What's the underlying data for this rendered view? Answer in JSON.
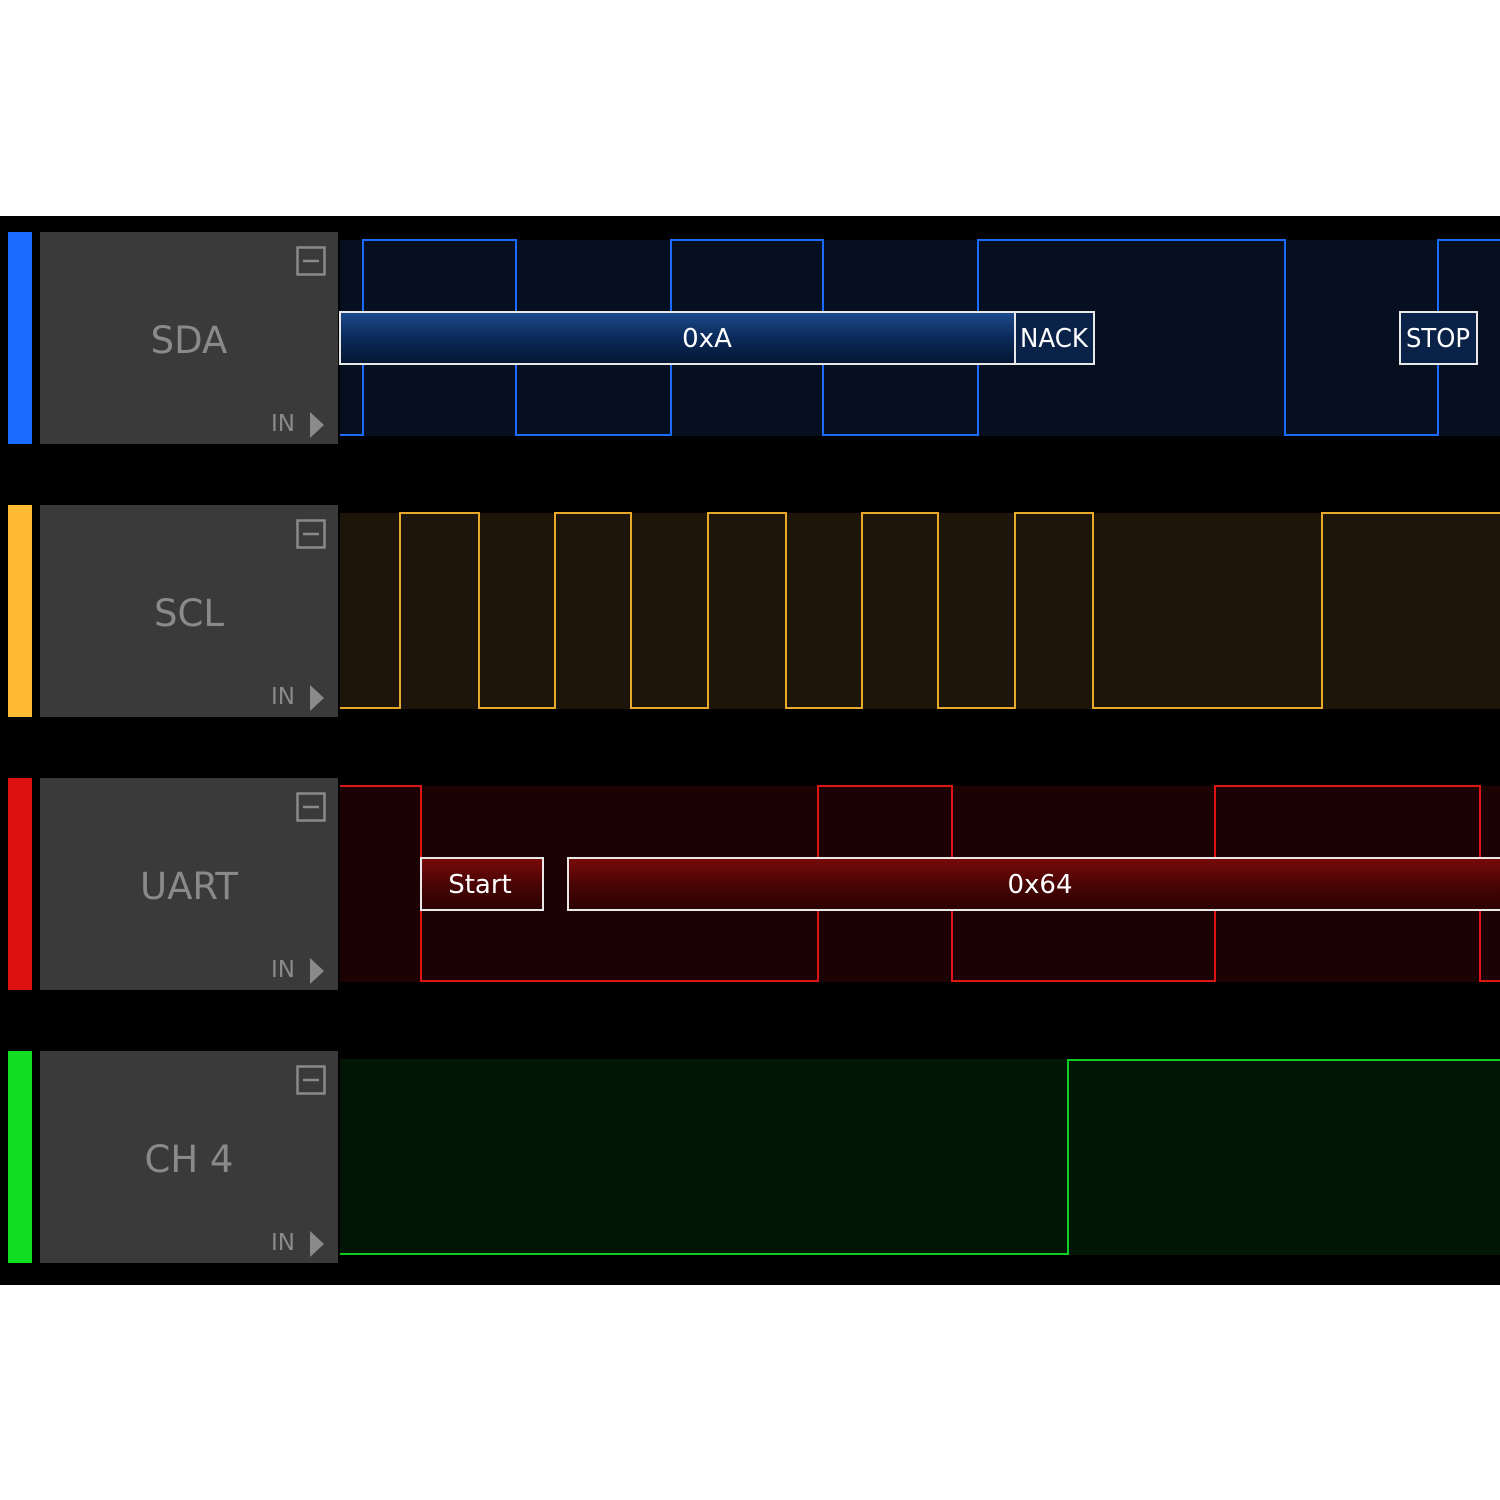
{
  "channels": [
    {
      "id": "sda",
      "name": "SDA",
      "io_label": "IN",
      "color": "#1a6cff",
      "bg_color": "#050f1f",
      "line_color": "#1a6cff",
      "decodes": [
        {
          "label": "0xA",
          "type": "data"
        },
        {
          "label": "NACK",
          "type": "ack"
        },
        {
          "label": "STOP",
          "type": "stop"
        }
      ]
    },
    {
      "id": "scl",
      "name": "SCL",
      "io_label": "IN",
      "color": "#ffbb33",
      "bg_color": "#1d150a",
      "line_color": "#e8a82a",
      "decodes": []
    },
    {
      "id": "uart",
      "name": "UART",
      "io_label": "IN",
      "color": "#dd1010",
      "bg_color": "#1c0202",
      "line_color": "#dd1515",
      "decodes": [
        {
          "label": "Start",
          "type": "start"
        },
        {
          "label": "0x64",
          "type": "data"
        }
      ]
    },
    {
      "id": "ch4",
      "name": "CH 4",
      "io_label": "IN",
      "color": "#11dd22",
      "bg_color": "#031505",
      "line_color": "#11cc22",
      "decodes": []
    }
  ],
  "icons": {
    "collapse": "collapse-icon",
    "input_arrow": "input-arrow-icon"
  }
}
